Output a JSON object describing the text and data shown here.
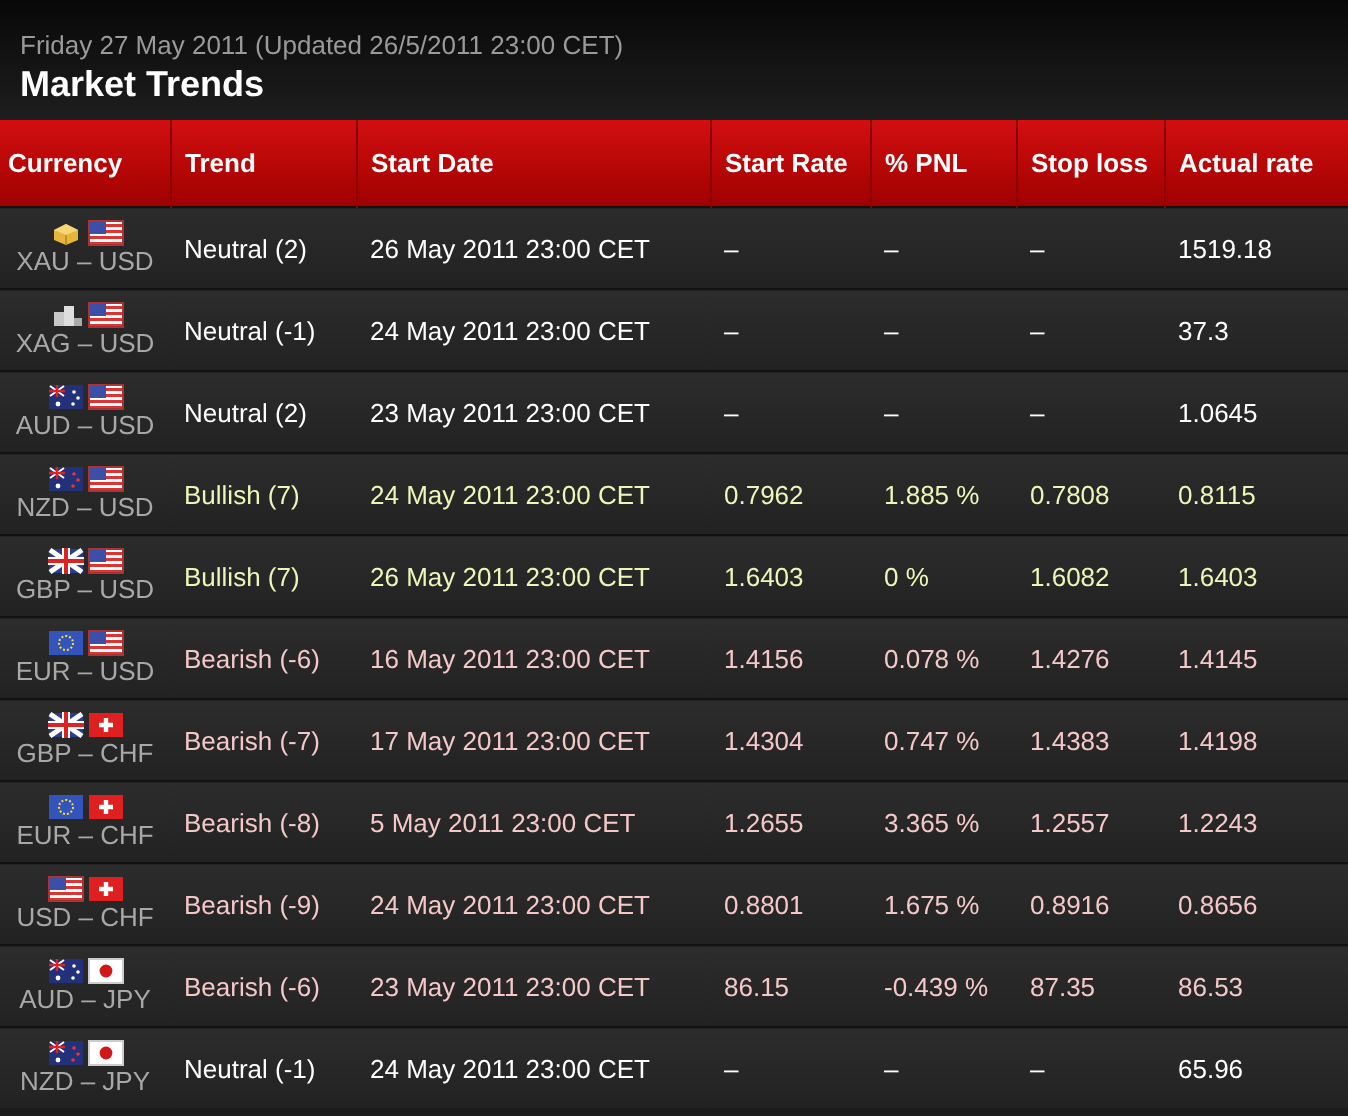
{
  "header": {
    "date_line": "Friday 27 May 2011 (Updated 26/5/2011 23:00 CET)",
    "title": "Market Trends"
  },
  "table": {
    "columns": [
      "Currency",
      "Trend",
      "Start Date",
      "Start Rate",
      "% PNL",
      "Stop loss",
      "Actual rate"
    ],
    "rows": [
      {
        "flags": [
          {
            "kind": "gold"
          },
          {
            "kind": "us"
          }
        ],
        "pair": "XAU – USD",
        "trend": "Neutral (2)",
        "kind": "neutral",
        "start_date": "26 May 2011 23:00 CET",
        "start_rate": "–",
        "pnl": "–",
        "stop_loss": "–",
        "actual_rate": "1519.18"
      },
      {
        "flags": [
          {
            "kind": "silver"
          },
          {
            "kind": "us"
          }
        ],
        "pair": "XAG – USD",
        "trend": "Neutral (-1)",
        "kind": "neutral",
        "start_date": "24 May 2011 23:00 CET",
        "start_rate": "–",
        "pnl": "–",
        "stop_loss": "–",
        "actual_rate": "37.3"
      },
      {
        "flags": [
          {
            "kind": "au"
          },
          {
            "kind": "us"
          }
        ],
        "pair": "AUD – USD",
        "trend": "Neutral (2)",
        "kind": "neutral",
        "start_date": "23 May 2011 23:00 CET",
        "start_rate": "–",
        "pnl": "–",
        "stop_loss": "–",
        "actual_rate": "1.0645"
      },
      {
        "flags": [
          {
            "kind": "nz"
          },
          {
            "kind": "us"
          }
        ],
        "pair": "NZD – USD",
        "trend": "Bullish (7)",
        "kind": "bullish",
        "start_date": "24 May 2011 23:00 CET",
        "start_rate": "0.7962",
        "pnl": "1.885 %",
        "stop_loss": "0.7808",
        "actual_rate": "0.8115"
      },
      {
        "flags": [
          {
            "kind": "gb"
          },
          {
            "kind": "us"
          }
        ],
        "pair": "GBP – USD",
        "trend": "Bullish (7)",
        "kind": "bullish",
        "start_date": "26 May 2011 23:00 CET",
        "start_rate": "1.6403",
        "pnl": "0 %",
        "stop_loss": "1.6082",
        "actual_rate": "1.6403"
      },
      {
        "flags": [
          {
            "kind": "eu"
          },
          {
            "kind": "us"
          }
        ],
        "pair": "EUR – USD",
        "trend": "Bearish (-6)",
        "kind": "bearish",
        "start_date": "16 May 2011 23:00 CET",
        "start_rate": "1.4156",
        "pnl": "0.078 %",
        "stop_loss": "1.4276",
        "actual_rate": "1.4145"
      },
      {
        "flags": [
          {
            "kind": "gb"
          },
          {
            "kind": "ch"
          }
        ],
        "pair": "GBP – CHF",
        "trend": "Bearish (-7)",
        "kind": "bearish",
        "start_date": "17 May 2011 23:00 CET",
        "start_rate": "1.4304",
        "pnl": "0.747 %",
        "stop_loss": "1.4383",
        "actual_rate": "1.4198"
      },
      {
        "flags": [
          {
            "kind": "eu"
          },
          {
            "kind": "ch"
          }
        ],
        "pair": "EUR – CHF",
        "trend": "Bearish (-8)",
        "kind": "bearish",
        "start_date": "5 May 2011 23:00 CET",
        "start_rate": "1.2655",
        "pnl": "3.365 %",
        "stop_loss": "1.2557",
        "actual_rate": "1.2243"
      },
      {
        "flags": [
          {
            "kind": "us"
          },
          {
            "kind": "ch"
          }
        ],
        "pair": "USD – CHF",
        "trend": "Bearish (-9)",
        "kind": "bearish",
        "start_date": "24 May 2011 23:00 CET",
        "start_rate": "0.8801",
        "pnl": "1.675 %",
        "stop_loss": "0.8916",
        "actual_rate": "0.8656"
      },
      {
        "flags": [
          {
            "kind": "au"
          },
          {
            "kind": "jp"
          }
        ],
        "pair": "AUD – JPY",
        "trend": "Bearish (-6)",
        "kind": "bearish",
        "start_date": "23 May 2011 23:00 CET",
        "start_rate": "86.15",
        "pnl": "-0.439 %",
        "stop_loss": "87.35",
        "actual_rate": "86.53"
      },
      {
        "flags": [
          {
            "kind": "nz"
          },
          {
            "kind": "jp"
          }
        ],
        "pair": "NZD – JPY",
        "trend": "Neutral (-1)",
        "kind": "neutral",
        "start_date": "24 May 2011 23:00 CET",
        "start_rate": "–",
        "pnl": "–",
        "stop_loss": "–",
        "actual_rate": "65.96"
      }
    ]
  }
}
